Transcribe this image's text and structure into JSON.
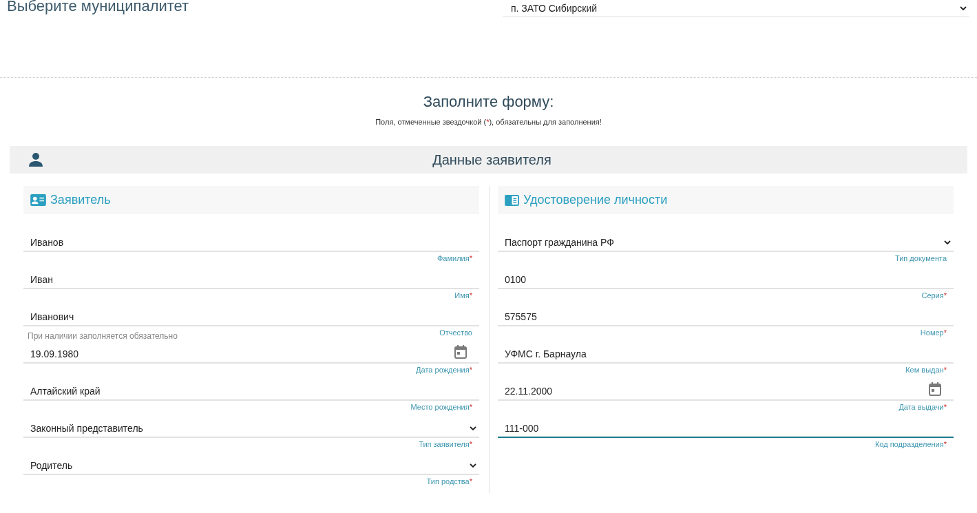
{
  "municipality": {
    "title": "Выберите муниципалитет",
    "value": "п. ЗАТО Сибирский"
  },
  "form_heading": {
    "title": "Заполните форму:",
    "note_before": "Поля, отмеченные звездочкой (",
    "note_mark": "*",
    "note_after": "), обязательны для заполнения!"
  },
  "section": {
    "title": "Данные заявителя"
  },
  "columns": [
    {
      "title": "Заявитель",
      "fields": [
        {
          "kind": "text",
          "value": "Иванов",
          "label": "Фамилия",
          "mark": "*",
          "focused": false
        },
        {
          "kind": "text",
          "value": "Иван",
          "label": "Имя",
          "mark": "*",
          "focused": false
        },
        {
          "kind": "text",
          "value": "Иванович",
          "label": "Отчество",
          "hint": "При наличии заполняется обязательно",
          "focused": false
        },
        {
          "kind": "date",
          "value": "19.09.1980",
          "label": "Дата рождения",
          "mark": "*",
          "focused": false
        },
        {
          "kind": "text",
          "value": "Алтайский край",
          "label": "Место рождения",
          "mark": "*",
          "focused": false
        },
        {
          "kind": "select",
          "value": "Законный представитель",
          "label": "Тип заявителя",
          "mark": "*",
          "focused": false
        },
        {
          "kind": "select",
          "value": "Родитель",
          "label": "Тип родства",
          "mark": "*",
          "focused": false
        }
      ]
    },
    {
      "title": "Удостоверение личности",
      "fields": [
        {
          "kind": "select",
          "value": "Паспорт гражданина РФ",
          "label": "Тип документа",
          "focused": false
        },
        {
          "kind": "text",
          "value": "0100",
          "label": "Серия",
          "mark": "*",
          "focused": false
        },
        {
          "kind": "text",
          "value": "575575",
          "label": "Номер",
          "mark": "*",
          "focused": false
        },
        {
          "kind": "text",
          "value": "УФМС г. Барнаула",
          "label": "Кем выдан",
          "mark": "*",
          "focused": false
        },
        {
          "kind": "date",
          "value": "22.11.2000",
          "label": "Дата выдачи",
          "mark": "*",
          "focused": false
        },
        {
          "kind": "text",
          "value": "111-000",
          "label": "Код подразделения",
          "mark": "*",
          "focused": true
        }
      ]
    }
  ]
}
